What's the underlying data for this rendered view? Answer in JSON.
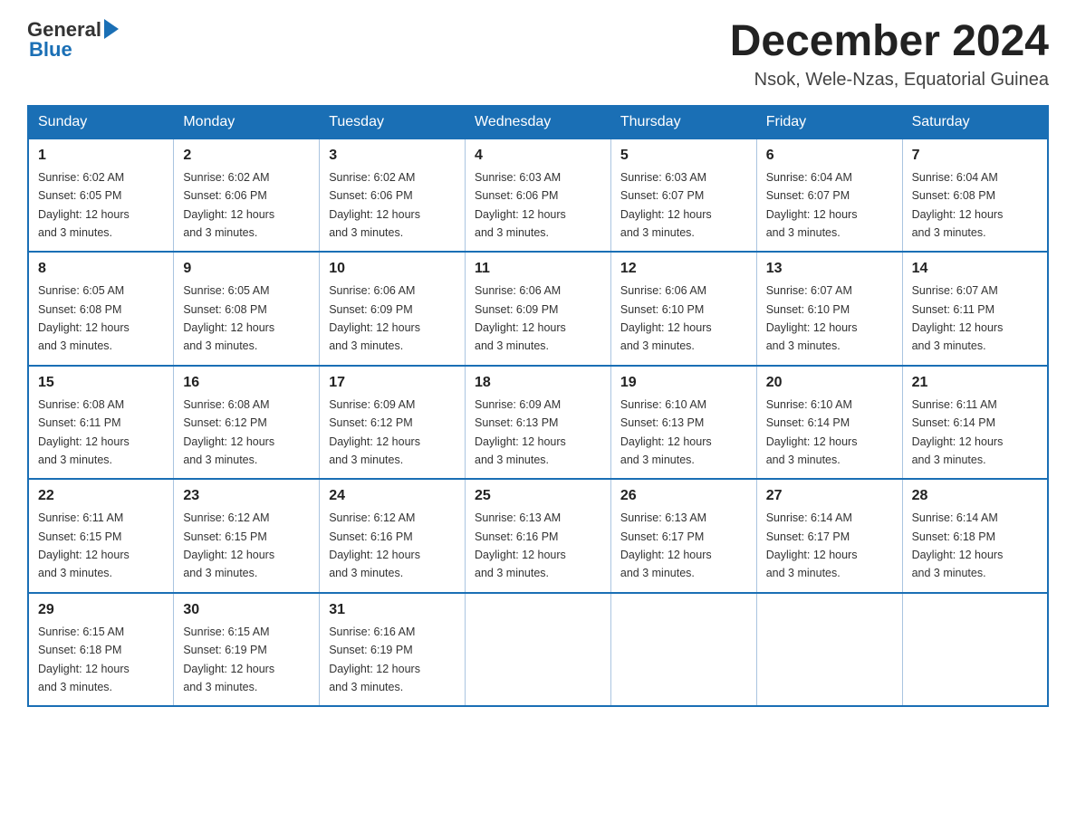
{
  "header": {
    "logo_general": "General",
    "logo_blue": "Blue",
    "month_title": "December 2024",
    "subtitle": "Nsok, Wele-Nzas, Equatorial Guinea"
  },
  "days_of_week": [
    "Sunday",
    "Monday",
    "Tuesday",
    "Wednesday",
    "Thursday",
    "Friday",
    "Saturday"
  ],
  "weeks": [
    [
      {
        "day": "1",
        "sunrise": "6:02 AM",
        "sunset": "6:05 PM",
        "daylight": "12 hours and 3 minutes."
      },
      {
        "day": "2",
        "sunrise": "6:02 AM",
        "sunset": "6:06 PM",
        "daylight": "12 hours and 3 minutes."
      },
      {
        "day": "3",
        "sunrise": "6:02 AM",
        "sunset": "6:06 PM",
        "daylight": "12 hours and 3 minutes."
      },
      {
        "day": "4",
        "sunrise": "6:03 AM",
        "sunset": "6:06 PM",
        "daylight": "12 hours and 3 minutes."
      },
      {
        "day": "5",
        "sunrise": "6:03 AM",
        "sunset": "6:07 PM",
        "daylight": "12 hours and 3 minutes."
      },
      {
        "day": "6",
        "sunrise": "6:04 AM",
        "sunset": "6:07 PM",
        "daylight": "12 hours and 3 minutes."
      },
      {
        "day": "7",
        "sunrise": "6:04 AM",
        "sunset": "6:08 PM",
        "daylight": "12 hours and 3 minutes."
      }
    ],
    [
      {
        "day": "8",
        "sunrise": "6:05 AM",
        "sunset": "6:08 PM",
        "daylight": "12 hours and 3 minutes."
      },
      {
        "day": "9",
        "sunrise": "6:05 AM",
        "sunset": "6:08 PM",
        "daylight": "12 hours and 3 minutes."
      },
      {
        "day": "10",
        "sunrise": "6:06 AM",
        "sunset": "6:09 PM",
        "daylight": "12 hours and 3 minutes."
      },
      {
        "day": "11",
        "sunrise": "6:06 AM",
        "sunset": "6:09 PM",
        "daylight": "12 hours and 3 minutes."
      },
      {
        "day": "12",
        "sunrise": "6:06 AM",
        "sunset": "6:10 PM",
        "daylight": "12 hours and 3 minutes."
      },
      {
        "day": "13",
        "sunrise": "6:07 AM",
        "sunset": "6:10 PM",
        "daylight": "12 hours and 3 minutes."
      },
      {
        "day": "14",
        "sunrise": "6:07 AM",
        "sunset": "6:11 PM",
        "daylight": "12 hours and 3 minutes."
      }
    ],
    [
      {
        "day": "15",
        "sunrise": "6:08 AM",
        "sunset": "6:11 PM",
        "daylight": "12 hours and 3 minutes."
      },
      {
        "day": "16",
        "sunrise": "6:08 AM",
        "sunset": "6:12 PM",
        "daylight": "12 hours and 3 minutes."
      },
      {
        "day": "17",
        "sunrise": "6:09 AM",
        "sunset": "6:12 PM",
        "daylight": "12 hours and 3 minutes."
      },
      {
        "day": "18",
        "sunrise": "6:09 AM",
        "sunset": "6:13 PM",
        "daylight": "12 hours and 3 minutes."
      },
      {
        "day": "19",
        "sunrise": "6:10 AM",
        "sunset": "6:13 PM",
        "daylight": "12 hours and 3 minutes."
      },
      {
        "day": "20",
        "sunrise": "6:10 AM",
        "sunset": "6:14 PM",
        "daylight": "12 hours and 3 minutes."
      },
      {
        "day": "21",
        "sunrise": "6:11 AM",
        "sunset": "6:14 PM",
        "daylight": "12 hours and 3 minutes."
      }
    ],
    [
      {
        "day": "22",
        "sunrise": "6:11 AM",
        "sunset": "6:15 PM",
        "daylight": "12 hours and 3 minutes."
      },
      {
        "day": "23",
        "sunrise": "6:12 AM",
        "sunset": "6:15 PM",
        "daylight": "12 hours and 3 minutes."
      },
      {
        "day": "24",
        "sunrise": "6:12 AM",
        "sunset": "6:16 PM",
        "daylight": "12 hours and 3 minutes."
      },
      {
        "day": "25",
        "sunrise": "6:13 AM",
        "sunset": "6:16 PM",
        "daylight": "12 hours and 3 minutes."
      },
      {
        "day": "26",
        "sunrise": "6:13 AM",
        "sunset": "6:17 PM",
        "daylight": "12 hours and 3 minutes."
      },
      {
        "day": "27",
        "sunrise": "6:14 AM",
        "sunset": "6:17 PM",
        "daylight": "12 hours and 3 minutes."
      },
      {
        "day": "28",
        "sunrise": "6:14 AM",
        "sunset": "6:18 PM",
        "daylight": "12 hours and 3 minutes."
      }
    ],
    [
      {
        "day": "29",
        "sunrise": "6:15 AM",
        "sunset": "6:18 PM",
        "daylight": "12 hours and 3 minutes."
      },
      {
        "day": "30",
        "sunrise": "6:15 AM",
        "sunset": "6:19 PM",
        "daylight": "12 hours and 3 minutes."
      },
      {
        "day": "31",
        "sunrise": "6:16 AM",
        "sunset": "6:19 PM",
        "daylight": "12 hours and 3 minutes."
      },
      null,
      null,
      null,
      null
    ]
  ],
  "labels": {
    "sunrise_prefix": "Sunrise: ",
    "sunset_prefix": "Sunset: ",
    "daylight_prefix": "Daylight: "
  }
}
